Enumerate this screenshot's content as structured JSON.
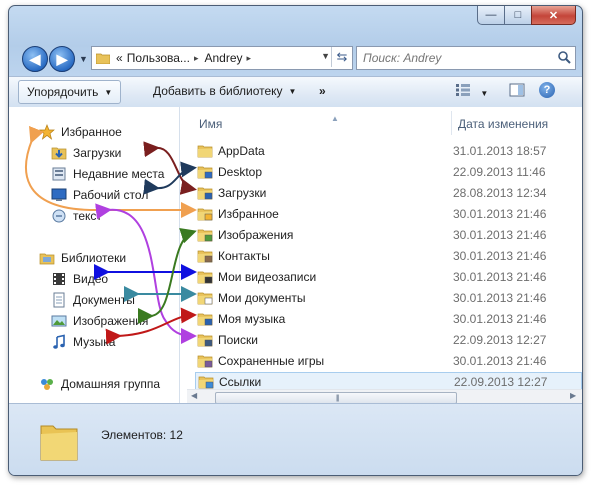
{
  "window": {
    "caption_buttons": {
      "minimize": "—",
      "maximize": "□",
      "close": "✕"
    }
  },
  "address_bar": {
    "back_icon": "arrow-left-icon",
    "forward_icon": "arrow-right-icon",
    "path_prefix": "«",
    "path": [
      "Пользова...",
      "Andrey"
    ],
    "path_separator": "▸",
    "refresh_icon": "refresh-icon"
  },
  "search": {
    "placeholder": "Поиск: Andrey"
  },
  "toolbar": {
    "organize": "Упорядочить",
    "add_to_library": "Добавить в библиотеку",
    "more": "»",
    "help": "?"
  },
  "nav_pane": {
    "favorites": {
      "label": "Избранное",
      "items": [
        "Загрузки",
        "Недавние места",
        "Рабочий стол",
        "текст"
      ]
    },
    "libraries": {
      "label": "Библиотеки",
      "items": [
        "Видео",
        "Документы",
        "Изображения",
        "Музыка"
      ]
    },
    "homegroup": "Домашняя группа"
  },
  "columns": {
    "name": "Имя",
    "date": "Дата изменения"
  },
  "files": [
    {
      "name": "AppData",
      "date": "31.01.2013 18:57",
      "icon": "folder"
    },
    {
      "name": "Desktop",
      "date": "22.09.2013 11:46",
      "icon": "desktop-folder"
    },
    {
      "name": "Загрузки",
      "date": "28.08.2013 12:34",
      "icon": "downloads-folder"
    },
    {
      "name": "Избранное",
      "date": "30.01.2013 21:46",
      "icon": "favorites-folder"
    },
    {
      "name": "Изображения",
      "date": "30.01.2013 21:46",
      "icon": "pictures-folder"
    },
    {
      "name": "Контакты",
      "date": "30.01.2013 21:46",
      "icon": "contacts-folder"
    },
    {
      "name": "Мои видеозаписи",
      "date": "30.01.2013 21:46",
      "icon": "videos-folder"
    },
    {
      "name": "Мои документы",
      "date": "30.01.2013 21:46",
      "icon": "documents-folder"
    },
    {
      "name": "Моя музыка",
      "date": "30.01.2013 21:46",
      "icon": "music-folder"
    },
    {
      "name": "Поиски",
      "date": "22.09.2013 12:27",
      "icon": "searches-folder"
    },
    {
      "name": "Сохраненные игры",
      "date": "30.01.2013 21:46",
      "icon": "games-folder"
    },
    {
      "name": "Ссылки",
      "date": "22.09.2013 12:27",
      "icon": "links-folder"
    }
  ],
  "status": {
    "count_label": "Элементов: 12"
  },
  "colors": {
    "arrow_downloads": "#7a1f1f",
    "arrow_desktop": "#1f3a5c",
    "arrow_favorites": "#f0a050",
    "arrow_text": "#b040e0",
    "arrow_video": "#1010e0",
    "arrow_documents": "#3a8aa0",
    "arrow_pictures": "#3a7a20",
    "arrow_music": "#c01818"
  }
}
